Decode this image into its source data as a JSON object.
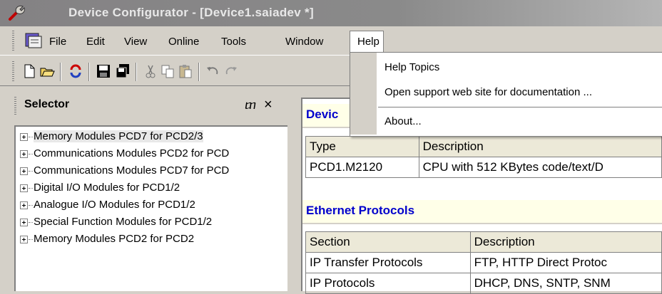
{
  "window": {
    "title": "Device Configurator - [Device1.saiadev *]"
  },
  "menu": {
    "items": [
      "File",
      "Edit",
      "View",
      "Online",
      "Tools",
      "Window",
      "Help"
    ],
    "help_dropdown": [
      "Help Topics",
      "Open support web site for documentation ...",
      "About..."
    ]
  },
  "toolbar": {
    "icons": [
      "new-icon",
      "open-icon",
      "refresh-icon",
      "save-icon",
      "save-all-icon",
      "cut-icon",
      "copy-icon",
      "paste-icon",
      "undo-icon",
      "redo-icon"
    ]
  },
  "selector": {
    "title": "Selector",
    "pin_glyph": "ⴇ",
    "close_glyph": "×",
    "items": [
      "Memory Modules PCD7 for PCD2/3",
      "Communications Modules PCD2 for PCD",
      "Communications Modules PCD7 for PCD",
      "Digital I/O Modules for PCD1/2",
      "Analogue I/O Modules for PCD1/2",
      "Special Function Modules for PCD1/2",
      "Memory Modules PCD2 for PCD2"
    ]
  },
  "device_section": {
    "title": "Devic",
    "headers": [
      "Type",
      "Description"
    ],
    "rows": [
      [
        "PCD1.M2120",
        "CPU with 512 KBytes code/text/D"
      ]
    ]
  },
  "ethernet_section": {
    "title": "Ethernet Protocols",
    "headers": [
      "Section",
      "Description"
    ],
    "rows": [
      [
        "IP Transfer Protocols",
        "FTP, HTTP Direct Protoc"
      ],
      [
        "IP Protocols",
        "DHCP, DNS, SNTP, SNM"
      ]
    ]
  },
  "colors": {
    "section_title": "#0000cc",
    "title_bar": "#848284"
  }
}
